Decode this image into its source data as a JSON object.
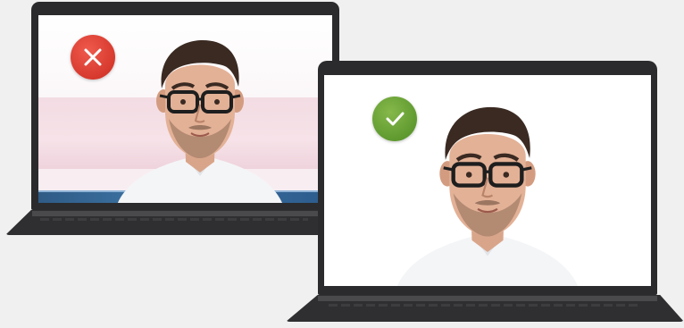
{
  "comparison": {
    "bad_example": {
      "status_icon": "cross-icon",
      "status_color": "#d7392d",
      "background_colors": [
        "#ffffff",
        "#f3dce3",
        "#3d74a5"
      ]
    },
    "good_example": {
      "status_icon": "check-icon",
      "status_color": "#5f9a2f",
      "background_colors": [
        "#ffffff"
      ]
    }
  },
  "colors": {
    "page_background": "#f0f0f0",
    "laptop_body": "#2b2b2d"
  }
}
